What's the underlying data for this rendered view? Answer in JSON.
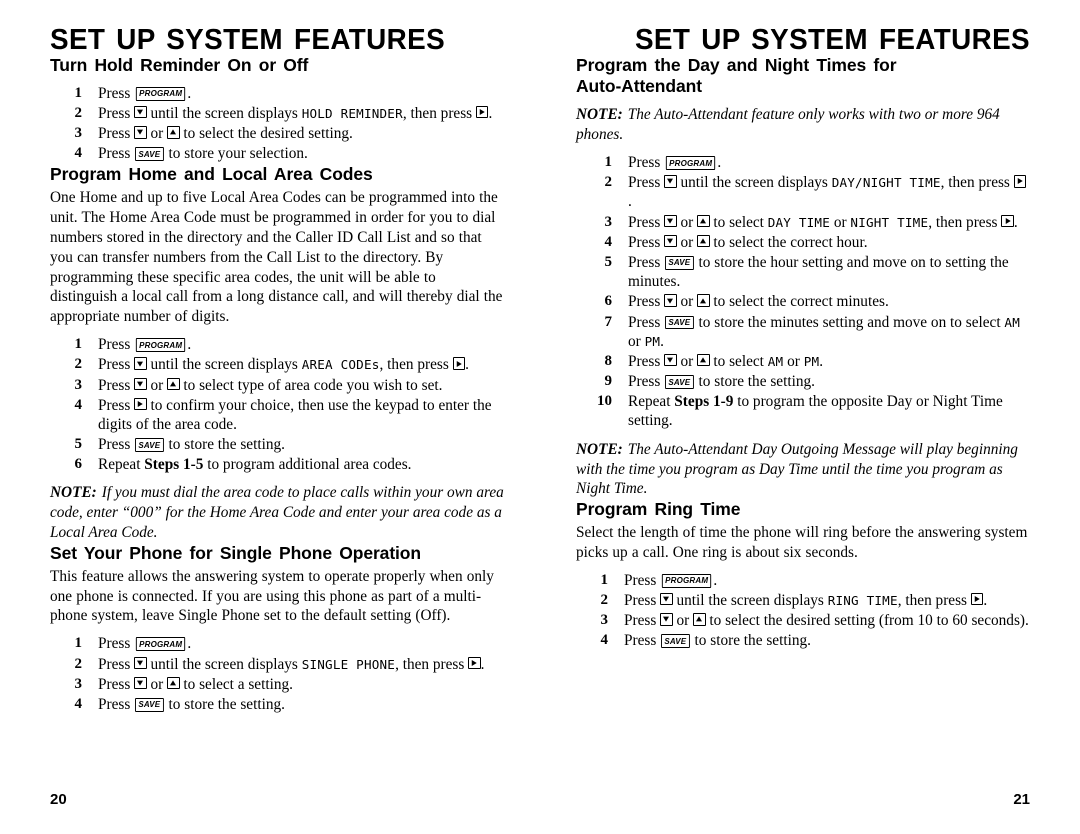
{
  "pages": {
    "left": {
      "running_title": "SET UP SYSTEM FEATURES",
      "page_number": "20",
      "sections": {
        "hold_reminder": {
          "heading": "Turn Hold Reminder On or Off",
          "steps": {
            "s1": {
              "num": "1",
              "pre": "Press ",
              "key": "PROGRAM",
              "post": "."
            },
            "s2": {
              "num": "2",
              "pre": "Press ",
              "mid": " until the screen displays ",
              "lcd": "HOLD REMINDER",
              "tail": ", then press ",
              "end": "."
            },
            "s3": {
              "num": "3",
              "pre": "Press ",
              "mid": " or ",
              "post": " to select the desired setting."
            },
            "s4": {
              "num": "4",
              "pre": "Press ",
              "key": "SAVE",
              "post": " to store your selection."
            }
          }
        },
        "area_codes": {
          "heading": "Program Home and Local Area Codes",
          "body": "One Home and up to five Local Area Codes can be programmed into the unit. The Home Area Code must be programmed in order for you to dial numbers stored in the directory and the Caller ID Call List and so that you can transfer numbers from the Call List to the directory.  By programming these specific area codes, the unit will be able to distinguish a local call from a long distance call, and will thereby dial the appropriate number of digits.",
          "steps": {
            "s1": {
              "num": "1",
              "pre": "Press ",
              "key": "PROGRAM",
              "post": "."
            },
            "s2": {
              "num": "2",
              "pre": "Press ",
              "mid": " until the screen displays ",
              "lcd": "AREA CODE",
              "lcd_tail": "s",
              "tail": ", then press ",
              "end": "."
            },
            "s3": {
              "num": "3",
              "pre": "Press ",
              "mid": " or ",
              "post": " to select type of area code you wish to set."
            },
            "s4": {
              "num": "4",
              "pre": "Press ",
              "post": " to confirm your choice, then use the keypad to enter the digits of the area code."
            },
            "s5": {
              "num": "5",
              "pre": "Press ",
              "key": "SAVE",
              "post": " to store the setting."
            },
            "s6": {
              "num": "6",
              "pre": "Repeat ",
              "ref": "Steps 1-5",
              "post": " to program additional area codes."
            }
          },
          "note_label": "NOTE:",
          "note_text": "If you must dial the area code to place calls within your own area code, enter “000” for the Home Area Code and enter your area code as a Local Area Code."
        },
        "single_phone": {
          "heading": "Set Your Phone for Single Phone Operation",
          "body": "This feature allows the answering system to operate properly when only one phone is connected.  If you are using this phone as part of a multi-phone system, leave Single Phone set to the default setting (Off).",
          "steps": {
            "s1": {
              "num": "1",
              "pre": "Press ",
              "key": "PROGRAM",
              "post": "."
            },
            "s2": {
              "num": "2",
              "pre": "Press ",
              "mid": " until the screen displays ",
              "lcd": "SINGLE PHONE",
              "tail": ", then press ",
              "end": "."
            },
            "s3": {
              "num": "3",
              "pre": "Press ",
              "mid": " or ",
              "post": " to select a setting."
            },
            "s4": {
              "num": "4",
              "pre": "Press ",
              "key": "SAVE",
              "post": " to store the setting."
            }
          }
        }
      }
    },
    "right": {
      "running_title": "SET UP SYSTEM FEATURES",
      "page_number": "21",
      "sections": {
        "day_night": {
          "heading_line1": "Program the Day and Night Times for",
          "heading_line2": "Auto-Attendant",
          "note_label": "NOTE:",
          "note_text": "The Auto-Attendant feature only works with two or more 964 phones.",
          "steps": {
            "s1": {
              "num": "1",
              "pre": "Press ",
              "key": "PROGRAM",
              "post": "."
            },
            "s2": {
              "num": "2",
              "pre": "Press ",
              "mid": " until the screen displays ",
              "lcd": "DAY/NIGHT TIME",
              "tail": ", then press ",
              "end": "."
            },
            "s3": {
              "num": "3",
              "pre": "Press ",
              "mid": " or ",
              "mid2": " to select ",
              "lcd1": "DAY TIME",
              "mid3": " or ",
              "lcd2": "NIGHT TIME",
              "tail": ", then press ",
              "end": "."
            },
            "s4": {
              "num": "4",
              "pre": "Press ",
              "mid": " or ",
              "post": " to select the correct hour."
            },
            "s5": {
              "num": "5",
              "pre": "Press ",
              "key": "SAVE",
              "post": " to store the hour setting and move on to setting the minutes."
            },
            "s6": {
              "num": "6",
              "pre": "Press ",
              "mid": " or ",
              "post": " to select the correct minutes."
            },
            "s7": {
              "num": "7",
              "pre": "Press ",
              "key": "SAVE",
              "mid": " to store the minutes setting and move on to select ",
              "lcd1": "AM",
              "mid2": " or ",
              "lcd2": "PM",
              "end": "."
            },
            "s8": {
              "num": "8",
              "pre": "Press ",
              "mid": " or ",
              "mid2": " to select ",
              "lcd1": "AM",
              "mid3": " or ",
              "lcd2": "PM",
              "end": "."
            },
            "s9": {
              "num": "9",
              "pre": "Press ",
              "key": "SAVE",
              "post": " to store the setting."
            },
            "s10": {
              "num": "10",
              "pre": "Repeat ",
              "ref": "Steps 1-9",
              "post": " to program the opposite Day or Night Time setting."
            }
          },
          "note2_label": "NOTE:",
          "note2_text": "The Auto-Attendant Day Outgoing Message will play beginning with the time you program as Day Time until the time you program as Night Time."
        },
        "ring_time": {
          "heading": "Program Ring Time",
          "body": "Select the length of time the phone will ring before the answering system picks up a call.  One ring is about six seconds.",
          "steps": {
            "s1": {
              "num": "1",
              "pre": "Press ",
              "key": "PROGRAM",
              "post": "."
            },
            "s2": {
              "num": "2",
              "pre": "Press ",
              "mid": " until the screen displays ",
              "lcd": "RING TIME",
              "tail": ", then press ",
              "end": "."
            },
            "s3": {
              "num": "3",
              "pre": "Press ",
              "mid": " or ",
              "post": " to select the desired setting (from 10 to 60 seconds)."
            },
            "s4": {
              "num": "4",
              "pre": "Press ",
              "key": "SAVE",
              "post": " to store the setting."
            }
          }
        }
      }
    }
  }
}
